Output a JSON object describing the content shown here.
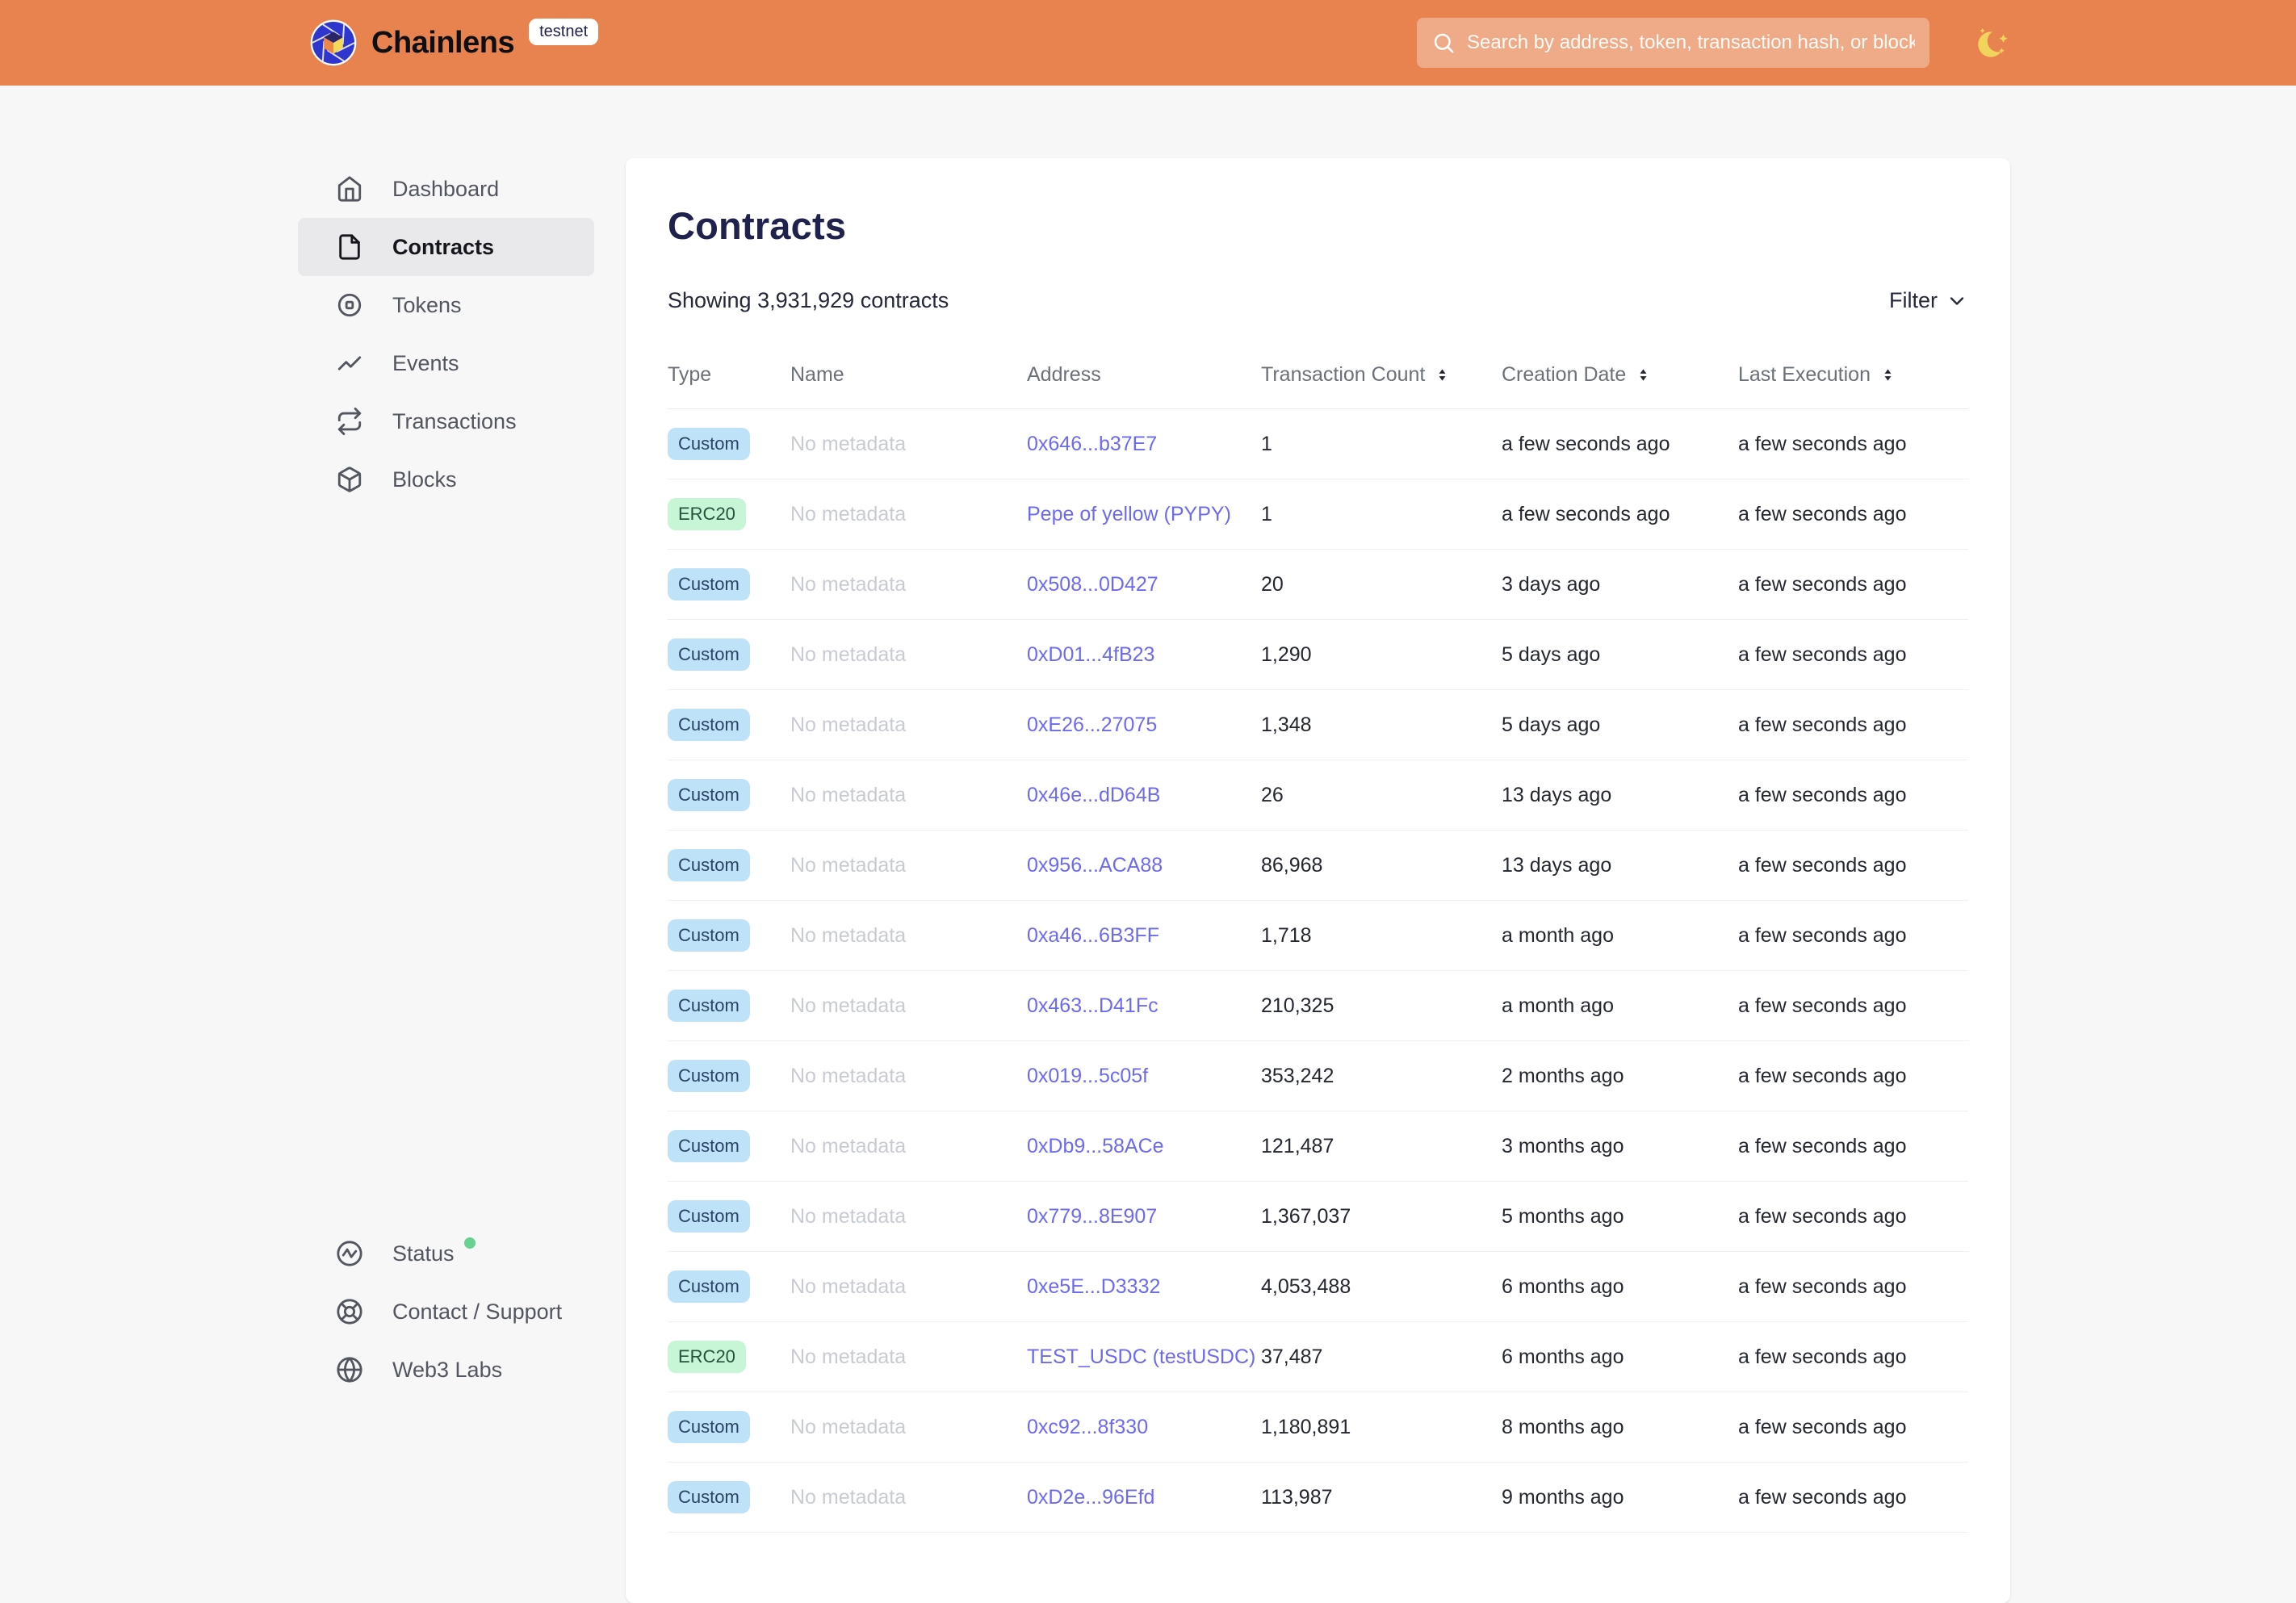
{
  "header": {
    "brand": "Chainlens",
    "network_badge": "testnet",
    "search": {
      "placeholder": "Search by address, token, transaction hash, or block number"
    }
  },
  "sidebar": {
    "items": [
      {
        "label": "Dashboard",
        "icon": "home-icon",
        "active": false
      },
      {
        "label": "Contracts",
        "icon": "file-icon",
        "active": true
      },
      {
        "label": "Tokens",
        "icon": "token-icon",
        "active": false
      },
      {
        "label": "Events",
        "icon": "events-icon",
        "active": false
      },
      {
        "label": "Transactions",
        "icon": "transactions-icon",
        "active": false
      },
      {
        "label": "Blocks",
        "icon": "blocks-icon",
        "active": false
      }
    ],
    "footer_items": [
      {
        "label": "Status",
        "icon": "status-icon",
        "status_dot": true
      },
      {
        "label": "Contact / Support",
        "icon": "support-icon",
        "status_dot": false
      },
      {
        "label": "Web3 Labs",
        "icon": "globe-icon",
        "status_dot": false
      }
    ]
  },
  "main": {
    "title": "Contracts",
    "summary": "Showing 3,931,929 contracts",
    "filter": {
      "label": "Filter"
    },
    "table": {
      "columns": [
        {
          "label": "Type",
          "sortable": false
        },
        {
          "label": "Name",
          "sortable": false
        },
        {
          "label": "Address",
          "sortable": false
        },
        {
          "label": "Transaction Count",
          "sortable": true
        },
        {
          "label": "Creation Date",
          "sortable": true
        },
        {
          "label": "Last Execution",
          "sortable": true
        }
      ],
      "rows": [
        {
          "type": "Custom",
          "name": "No metadata",
          "address": "0x646...b37E7",
          "tx_count": "1",
          "creation_date": "a few seconds ago",
          "last_execution": "a few seconds ago"
        },
        {
          "type": "ERC20",
          "name": "No metadata",
          "address": "Pepe of yellow (PYPY)",
          "tx_count": "1",
          "creation_date": "a few seconds ago",
          "last_execution": "a few seconds ago"
        },
        {
          "type": "Custom",
          "name": "No metadata",
          "address": "0x508...0D427",
          "tx_count": "20",
          "creation_date": "3 days ago",
          "last_execution": "a few seconds ago"
        },
        {
          "type": "Custom",
          "name": "No metadata",
          "address": "0xD01...4fB23",
          "tx_count": "1,290",
          "creation_date": "5 days ago",
          "last_execution": "a few seconds ago"
        },
        {
          "type": "Custom",
          "name": "No metadata",
          "address": "0xE26...27075",
          "tx_count": "1,348",
          "creation_date": "5 days ago",
          "last_execution": "a few seconds ago"
        },
        {
          "type": "Custom",
          "name": "No metadata",
          "address": "0x46e...dD64B",
          "tx_count": "26",
          "creation_date": "13 days ago",
          "last_execution": "a few seconds ago"
        },
        {
          "type": "Custom",
          "name": "No metadata",
          "address": "0x956...ACA88",
          "tx_count": "86,968",
          "creation_date": "13 days ago",
          "last_execution": "a few seconds ago"
        },
        {
          "type": "Custom",
          "name": "No metadata",
          "address": "0xa46...6B3FF",
          "tx_count": "1,718",
          "creation_date": "a month ago",
          "last_execution": "a few seconds ago"
        },
        {
          "type": "Custom",
          "name": "No metadata",
          "address": "0x463...D41Fc",
          "tx_count": "210,325",
          "creation_date": "a month ago",
          "last_execution": "a few seconds ago"
        },
        {
          "type": "Custom",
          "name": "No metadata",
          "address": "0x019...5c05f",
          "tx_count": "353,242",
          "creation_date": "2 months ago",
          "last_execution": "a few seconds ago"
        },
        {
          "type": "Custom",
          "name": "No metadata",
          "address": "0xDb9...58ACe",
          "tx_count": "121,487",
          "creation_date": "3 months ago",
          "last_execution": "a few seconds ago"
        },
        {
          "type": "Custom",
          "name": "No metadata",
          "address": "0x779...8E907",
          "tx_count": "1,367,037",
          "creation_date": "5 months ago",
          "last_execution": "a few seconds ago"
        },
        {
          "type": "Custom",
          "name": "No metadata",
          "address": "0xe5E...D3332",
          "tx_count": "4,053,488",
          "creation_date": "6 months ago",
          "last_execution": "a few seconds ago"
        },
        {
          "type": "ERC20",
          "name": "No metadata",
          "address": "TEST_USDC (testUSDC)",
          "tx_count": "37,487",
          "creation_date": "6 months ago",
          "last_execution": "a few seconds ago"
        },
        {
          "type": "Custom",
          "name": "No metadata",
          "address": "0xc92...8f330",
          "tx_count": "1,180,891",
          "creation_date": "8 months ago",
          "last_execution": "a few seconds ago"
        },
        {
          "type": "Custom",
          "name": "No metadata",
          "address": "0xD2e...96Efd",
          "tx_count": "113,987",
          "creation_date": "9 months ago",
          "last_execution": "a few seconds ago"
        }
      ]
    }
  },
  "colors": {
    "header_bg": "#E8834F",
    "accent_link": "#6C6AF0",
    "title_text": "#20224E",
    "badge_custom_bg": "#BEE3F8",
    "badge_custom_text": "#2A4365",
    "badge_erc20_bg": "#C6F6D5",
    "badge_erc20_text": "#22543D",
    "status_dot": "#68D391"
  }
}
